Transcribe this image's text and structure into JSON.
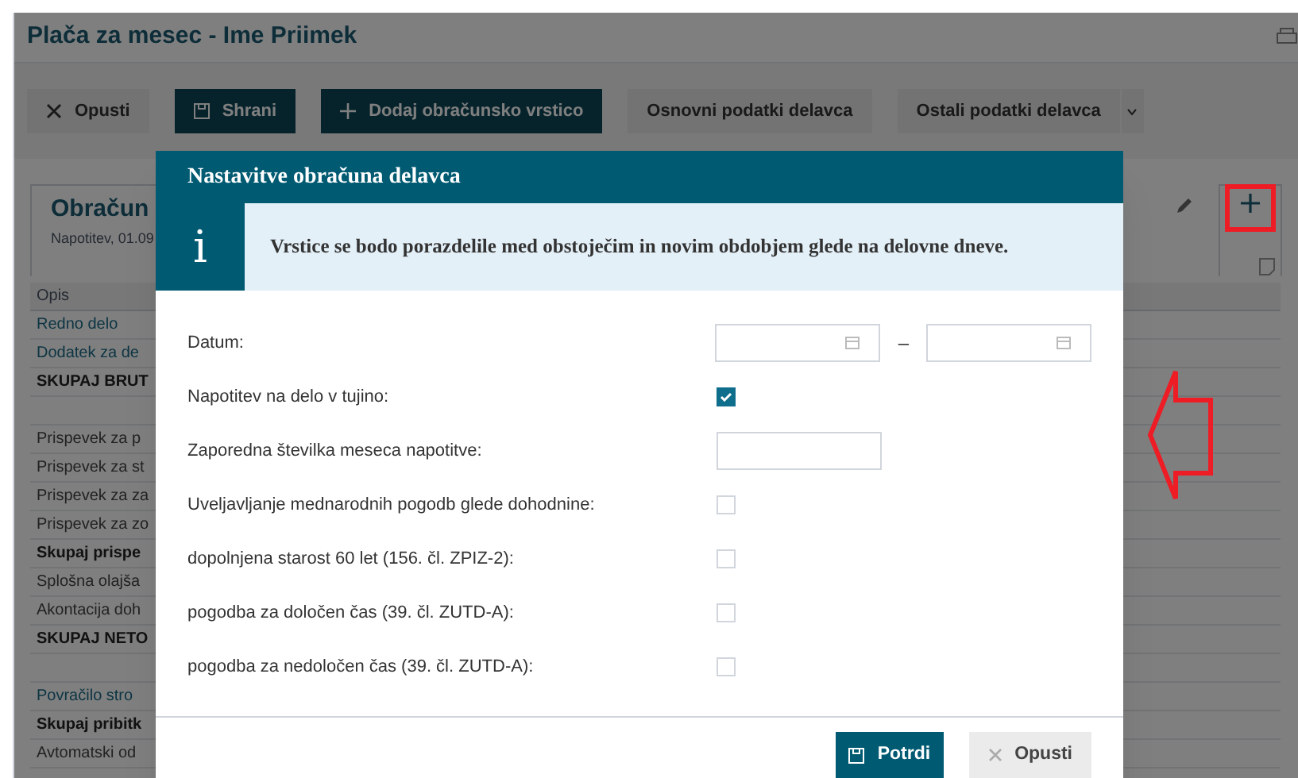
{
  "window": {
    "title": "Plača za mesec - Ime Priimek"
  },
  "toolbar": [
    {
      "label": "Opusti",
      "kind": "close"
    },
    {
      "label": "Shrani",
      "kind": "save"
    },
    {
      "label": "Dodaj obračunsko vrstico",
      "kind": "add"
    },
    {
      "label": "Osnovni podatki delavca",
      "kind": "plain"
    },
    {
      "label": "Ostali podatki delavca",
      "kind": "dropdown"
    }
  ],
  "panel": {
    "title": "Obračun",
    "subtitle": "Napotitev, 01.09"
  },
  "table": {
    "columns": [
      "Opis"
    ],
    "rows": [
      {
        "text": "Redno delo",
        "kind": "link"
      },
      {
        "text": "Dodatek za de",
        "kind": "link"
      },
      {
        "text": "SKUPAJ BRUT",
        "kind": "bold"
      },
      {
        "kind": "blank"
      },
      {
        "text": "Prispevek za p",
        "kind": "plain"
      },
      {
        "text": "Prispevek za st",
        "kind": "plain"
      },
      {
        "text": "Prispevek za za",
        "kind": "plain"
      },
      {
        "text": "Prispevek za zo",
        "kind": "plain"
      },
      {
        "text": "Skupaj prispe",
        "kind": "bold"
      },
      {
        "text": "Splošna olajša",
        "kind": "plain"
      },
      {
        "text": "Akontacija doh",
        "kind": "plain"
      },
      {
        "text": "SKUPAJ NETO",
        "kind": "bold"
      },
      {
        "kind": "blank"
      },
      {
        "text": "Povračilo stro",
        "kind": "link"
      },
      {
        "text": "Skupaj pribitk",
        "kind": "bold"
      },
      {
        "text": "Avtomatski od",
        "kind": "plain"
      }
    ]
  },
  "dialog": {
    "title": "Nastavitve obračuna delavca",
    "info_icon": "i",
    "info": "Vrstice se bodo porazdelile med obstoječim in novim obdobjem glede na delovne dneve.",
    "fields": [
      {
        "label": "Datum:",
        "kind": "date_range",
        "separator": "–"
      },
      {
        "label": "Napotitev na delo v tujino:",
        "kind": "checkbox",
        "checked": true
      },
      {
        "label": "Zaporedna številka meseca napotitve:",
        "kind": "text"
      },
      {
        "label": "Uveljavljanje mednarodnih pogodb glede dohodnine:",
        "kind": "checkbox",
        "checked": false
      },
      {
        "label": "dopolnjena starost 60 let (156. čl. ZPIZ-2):",
        "kind": "checkbox",
        "checked": false
      },
      {
        "label": "pogodba za določen čas (39. čl. ZUTD-A):",
        "kind": "checkbox",
        "checked": false
      },
      {
        "label": "pogodba za nedoločen čas (39. čl. ZUTD-A):",
        "kind": "checkbox",
        "checked": false
      }
    ],
    "buttons": [
      {
        "label": "Potrdi",
        "kind": "primary"
      },
      {
        "label": "Opusti",
        "kind": "secondary"
      }
    ]
  }
}
